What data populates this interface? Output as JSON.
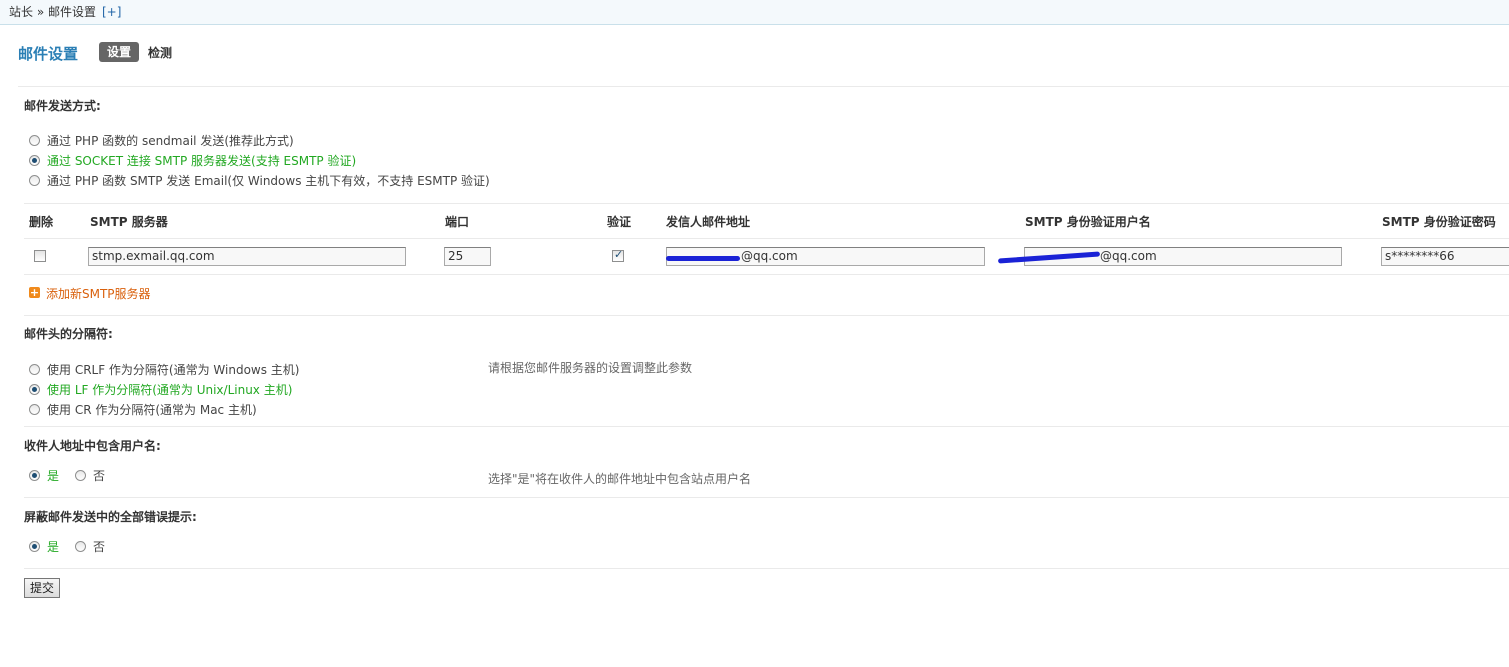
{
  "breadcrumb": {
    "path": "站长 » 邮件设置",
    "expand": "[+]"
  },
  "header": {
    "title": "邮件设置",
    "tabs": {
      "active": "设置",
      "other": "检测"
    }
  },
  "send_method": {
    "title": "邮件发送方式:",
    "options": [
      "通过 PHP 函数的 sendmail 发送(推荐此方式)",
      "通过 SOCKET 连接 SMTP 服务器发送(支持 ESMTP 验证)",
      "通过 PHP 函数 SMTP 发送 Email(仅 Windows 主机下有效，不支持 ESMTP 验证)"
    ],
    "selected": 1
  },
  "smtp_table": {
    "headers": {
      "delete": "删除",
      "server": "SMTP 服务器",
      "port": "端口",
      "auth": "验证",
      "from": "发信人邮件地址",
      "user": "SMTP 身份验证用户名",
      "password": "SMTP 身份验证密码"
    },
    "row": {
      "server": "stmp.exmail.qq.com",
      "port": "25",
      "from_visible": "@qq.com",
      "user_visible": "@qq.com",
      "password": "s********66",
      "deleted": false,
      "auth": true
    },
    "add_label": "添加新SMTP服务器"
  },
  "separator": {
    "title": "邮件头的分隔符:",
    "options": [
      "使用 CRLF 作为分隔符(通常为 Windows 主机)",
      "使用 LF 作为分隔符(通常为 Unix/Linux 主机)",
      "使用 CR 作为分隔符(通常为 Mac 主机)"
    ],
    "selected": 1,
    "hint": "请根据您邮件服务器的设置调整此参数"
  },
  "include_username": {
    "title": "收件人地址中包含用户名:",
    "yes": "是",
    "no": "否",
    "selected": "yes",
    "hint": "选择\"是\"将在收件人的邮件地址中包含站点用户名"
  },
  "mute_errors": {
    "title": "屏蔽邮件发送中的全部错误提示:",
    "yes": "是",
    "no": "否",
    "selected": "yes"
  },
  "submit_label": "提交",
  "colors": {
    "accent": "#2b7fb5",
    "selected_text": "#22a822",
    "link_orange": "#d9600c",
    "redaction": "#1a22d6"
  }
}
